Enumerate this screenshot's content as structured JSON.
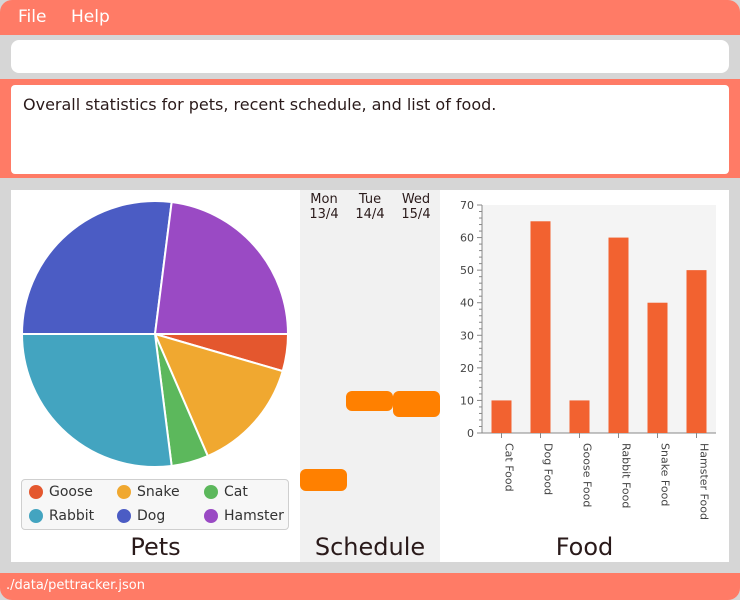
{
  "menu": {
    "file": "File",
    "help": "Help"
  },
  "command": {
    "value": "",
    "placeholder": ""
  },
  "result": {
    "text": "Overall statistics for pets, recent schedule, and list of food."
  },
  "pets": {
    "title": "Pets",
    "slices": [
      {
        "name": "Goose",
        "value": 4.5,
        "color": "#e4572e"
      },
      {
        "name": "Snake",
        "value": 14,
        "color": "#f0a830"
      },
      {
        "name": "Cat",
        "value": 4.5,
        "color": "#5cb85c"
      },
      {
        "name": "Rabbit",
        "value": 27,
        "color": "#43a4c0"
      },
      {
        "name": "Dog",
        "value": 27,
        "color": "#4b5cc4"
      },
      {
        "name": "Hamster",
        "value": 23,
        "color": "#9a4ac4"
      }
    ]
  },
  "schedule": {
    "title": "Schedule",
    "days": [
      {
        "name": "Mon",
        "date": "13/4"
      },
      {
        "name": "Tue",
        "date": "14/4"
      },
      {
        "name": "Wed",
        "date": "15/4"
      }
    ],
    "event_color": "#ff8000"
  },
  "food": {
    "title": "Food",
    "bar_color": "#f26230"
  },
  "chart_data": {
    "type": "bar",
    "categories": [
      "Cat Food",
      "Dog Food",
      "Goose Food",
      "Rabbit Food",
      "Snake Food",
      "Hamster Food"
    ],
    "values": [
      10,
      65,
      10,
      60,
      40,
      50
    ],
    "title": "Food",
    "xlabel": "",
    "ylabel": "",
    "ylim": [
      0,
      70
    ],
    "yticks": [
      0,
      10,
      20,
      30,
      40,
      50,
      60,
      70
    ],
    "grid": false
  },
  "footer": {
    "path": "./data/pettracker.json"
  }
}
